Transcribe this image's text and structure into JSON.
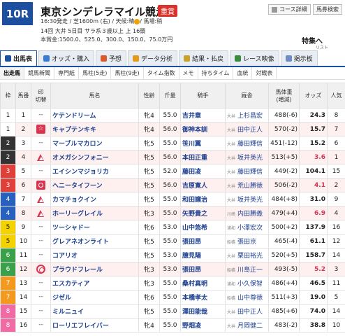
{
  "race": {
    "number": "10R",
    "name": "東京シンデレラマイル競走",
    "grade": "重賞",
    "line1": "16:30発走 / 芝1600m (右) / 天候:晴",
    "going": "/ 馬場:稍",
    "line2": "14回 大井 5日目 サラ系３歳以上 上            16頭",
    "line3": "本賞金:1500.0、525.0、300.0、150.0、75.0万円",
    "special": "特集へ",
    "status": "リスト"
  },
  "header_buttons": {
    "course": "コース詳細",
    "calendar": "馬券検索"
  },
  "tabs": [
    {
      "label": "出馬表",
      "active": true,
      "icon": "table-icon",
      "color": "#1c4f9f"
    },
    {
      "label": "オッズ・購入",
      "active": false,
      "icon": "ticket-icon",
      "color": "#3a7bd5"
    },
    {
      "label": "予想",
      "active": false,
      "icon": "prediction-icon",
      "color": "#d95a2b"
    },
    {
      "label": "データ分析",
      "active": false,
      "icon": "chart-icon",
      "color": "#e39b1b"
    },
    {
      "label": "結果・払戻",
      "active": false,
      "icon": "result-icon",
      "color": "#c8a22a"
    },
    {
      "label": "レース映像",
      "active": false,
      "icon": "video-icon",
      "color": "#3b8a3e"
    },
    {
      "label": "掲示板",
      "active": false,
      "icon": "board-icon",
      "color": "#6d8cc4"
    }
  ],
  "subtabs": [
    {
      "label": "出走馬",
      "active": true
    },
    {
      "label": "競馬新聞",
      "active": false
    },
    {
      "label": "専門紙",
      "active": false
    },
    {
      "label": "馬柱(5走)",
      "active": false
    },
    {
      "label": "馬柱(9走)",
      "active": false
    },
    {
      "label": "タイム指数",
      "active": false
    },
    {
      "label": "メモ",
      "active": false
    },
    {
      "label": "持ちタイム",
      "active": false
    },
    {
      "label": "血統",
      "active": false
    },
    {
      "label": "対戦表",
      "active": false
    }
  ],
  "columns": {
    "waku": "枠",
    "umaban": "馬番",
    "mark": "印",
    "mark_sub": "切替",
    "horse": "馬名",
    "sex_age": "性齢",
    "weight": "斤量",
    "jockey": "騎手",
    "trainer": "厩舎",
    "body_weight": "馬体重",
    "body_weight_sub": "(増減)",
    "odds": "オッズ",
    "popularity": "人気"
  },
  "waku_colors": {
    "1": {
      "bg": "#ffffff",
      "fg": "#222222"
    },
    "2": {
      "bg": "#333333",
      "fg": "#ffffff"
    },
    "3": {
      "bg": "#e0403a",
      "fg": "#ffffff"
    },
    "4": {
      "bg": "#2860c0",
      "fg": "#ffffff"
    },
    "5": {
      "bg": "#f3d200",
      "fg": "#222222"
    },
    "6": {
      "bg": "#3aa04a",
      "fg": "#ffffff"
    },
    "7": {
      "bg": "#f39a1e",
      "fg": "#ffffff"
    },
    "8": {
      "bg": "#f06aa4",
      "fg": "#ffffff"
    }
  },
  "entries": [
    {
      "waku": "1",
      "umaban": "1",
      "mark": "dash",
      "horse": "ケテンドリーム",
      "sex_age": "牝4",
      "weight": "55.0",
      "jockey": "吉井章",
      "pref": "大井",
      "trainer": "上杉昌宏",
      "body_weight": "488(-6)",
      "odds": "24.3",
      "pop": "8",
      "highlight": false
    },
    {
      "waku": "1",
      "umaban": "2",
      "mark": "star",
      "horse": "キャプテンキキ",
      "sex_age": "牝4",
      "weight": "56.0",
      "jockey": "御神本訓",
      "pref": "大井",
      "trainer": "田中正人",
      "body_weight": "570(-2)",
      "odds": "15.7",
      "pop": "7",
      "highlight": true
    },
    {
      "waku": "2",
      "umaban": "3",
      "mark": "dash",
      "horse": "マーブルマカロン",
      "sex_age": "牝5",
      "weight": "55.0",
      "jockey": "笹川翼",
      "pref": "大井",
      "trainer": "藤田輝信",
      "body_weight": "451(-12)",
      "odds": "15.2",
      "pop": "6",
      "highlight": false
    },
    {
      "waku": "2",
      "umaban": "4",
      "mark": "tri",
      "horse": "オメガシンフォニー",
      "sex_age": "牝5",
      "weight": "56.0",
      "jockey": "本田正重",
      "pref": "大井",
      "trainer": "坂井英光",
      "body_weight": "513(+5)",
      "odds": "3.6",
      "pop": "1",
      "highlight": true
    },
    {
      "waku": "3",
      "umaban": "5",
      "mark": "dash",
      "horse": "エイシンマジョリカ",
      "sex_age": "牝5",
      "weight": "52.0",
      "jockey": "藤田凌",
      "pref": "大井",
      "trainer": "藤田輝信",
      "body_weight": "449(-2)",
      "odds": "104.1",
      "pop": "15",
      "highlight": false
    },
    {
      "waku": "3",
      "umaban": "6",
      "mark": "circ",
      "horse": "ヘニータイフーン",
      "sex_age": "牝5",
      "weight": "56.0",
      "jockey": "吉原寛人",
      "pref": "大井",
      "trainer": "荒山勝徳",
      "body_weight": "506(-2)",
      "odds": "4.1",
      "pop": "2",
      "highlight": true
    },
    {
      "waku": "4",
      "umaban": "7",
      "mark": "tri",
      "horse": "カマチョクイン",
      "sex_age": "牝5",
      "weight": "55.0",
      "jockey": "和田譲治",
      "pref": "大井",
      "trainer": "坂井英光",
      "body_weight": "484(+8)",
      "odds": "31.0",
      "pop": "9",
      "highlight": false
    },
    {
      "waku": "4",
      "umaban": "8",
      "mark": "tri",
      "horse": "ホーリーグレイル",
      "sex_age": "牝3",
      "weight": "55.0",
      "jockey": "矢野貴之",
      "pref": "川崎",
      "trainer": "内田勝義",
      "body_weight": "479(+4)",
      "odds": "6.9",
      "pop": "4",
      "highlight": true
    },
    {
      "waku": "5",
      "umaban": "9",
      "mark": "dash",
      "horse": "ツーシャドー",
      "sex_age": "牝6",
      "weight": "53.0",
      "jockey": "山中悠希",
      "pref": "浦和",
      "trainer": "小澤宏次",
      "body_weight": "500(+2)",
      "odds": "137.9",
      "pop": "16",
      "highlight": false
    },
    {
      "waku": "5",
      "umaban": "10",
      "mark": "dash",
      "horse": "グレアネオンライト",
      "sex_age": "牝5",
      "weight": "55.0",
      "jockey": "張田昂",
      "pref": "船橋",
      "trainer": "張田京",
      "body_weight": "465(-4)",
      "odds": "61.1",
      "pop": "12",
      "highlight": false
    },
    {
      "waku": "6",
      "umaban": "11",
      "mark": "dash",
      "horse": "コアリオ",
      "sex_age": "牝5",
      "weight": "53.0",
      "jockey": "臆見陽",
      "pref": "大井",
      "trainer": "栗田裕光",
      "body_weight": "520(+5)",
      "odds": "158.7",
      "pop": "14",
      "highlight": false
    },
    {
      "waku": "6",
      "umaban": "12",
      "mark": "dbl",
      "horse": "プラウドフレール",
      "sex_age": "牝3",
      "weight": "53.0",
      "jockey": "張田昂",
      "pref": "船橋",
      "trainer": "川島正一",
      "body_weight": "493(-5)",
      "odds": "5.2",
      "pop": "3",
      "highlight": true
    },
    {
      "waku": "7",
      "umaban": "13",
      "mark": "dash",
      "horse": "エスカティア",
      "sex_age": "牝3",
      "weight": "55.0",
      "jockey": "桑村真明",
      "pref": "浦和",
      "trainer": "小久保智",
      "body_weight": "486(+4)",
      "odds": "46.5",
      "pop": "11",
      "highlight": false
    },
    {
      "waku": "7",
      "umaban": "14",
      "mark": "dash",
      "horse": "ジゼル",
      "sex_age": "牝6",
      "weight": "55.0",
      "jockey": "本橋孝太",
      "pref": "船橋",
      "trainer": "山中尊徳",
      "body_weight": "511(+3)",
      "odds": "19.0",
      "pop": "5",
      "highlight": false
    },
    {
      "waku": "8",
      "umaban": "15",
      "mark": "dash",
      "horse": "ミルニュイ",
      "sex_age": "牝5",
      "weight": "55.0",
      "jockey": "澤田能哉",
      "pref": "大井",
      "trainer": "田中正人",
      "body_weight": "485(+6)",
      "odds": "74.0",
      "pop": "14",
      "highlight": false
    },
    {
      "waku": "8",
      "umaban": "16",
      "mark": "dash",
      "horse": "ローリエフレイバー",
      "sex_age": "牝4",
      "weight": "55.0",
      "jockey": "野畑凌",
      "pref": "大井",
      "trainer": "月岡健二",
      "body_weight": "483(-2)",
      "odds": "38.8",
      "pop": "10",
      "highlight": false
    }
  ]
}
